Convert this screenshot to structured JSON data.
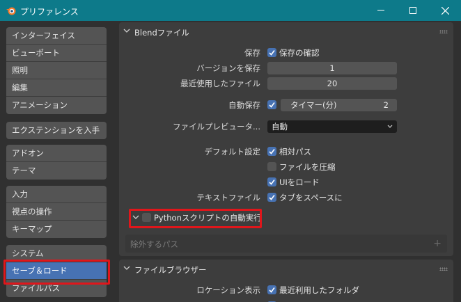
{
  "window": {
    "title": "プリファレンス",
    "minimize_glyph": "minimize",
    "maximize_glyph": "maximize",
    "close_glyph": "close"
  },
  "sidebar": {
    "groups": [
      [
        "インターフェイス",
        "ビューポート",
        "照明",
        "編集",
        "アニメーション"
      ],
      [
        "エクステンションを入手"
      ],
      [
        "アドオン",
        "テーマ"
      ],
      [
        "入力",
        "視点の操作",
        "キーマップ"
      ],
      [
        "システム",
        "セーブ＆ロード",
        "ファイルパス"
      ]
    ],
    "active": "セーブ＆ロード"
  },
  "blend_panel": {
    "title": "Blendファイル",
    "save_label": "保存",
    "save_confirm": "保存の確認",
    "save_versions_label": "バージョンを保存",
    "save_versions_value": "1",
    "recent_files_label": "最近使用したファイル",
    "recent_files_value": "20",
    "autosave_label": "自動保存",
    "timer_label": "タイマー(分)",
    "timer_value": "2",
    "file_preview_label": "ファイルプレビュータ...",
    "file_preview_value": "自動",
    "default_settings_label": "デフォルト設定",
    "relative_paths": "相対パス",
    "compress_file": "ファイルを圧縮",
    "load_ui": "UIをロード",
    "text_files_label": "テキストファイル",
    "tabs_as_spaces": "タブをスペースに"
  },
  "python_subpanel": {
    "title": "Pythonスクリプトの自動実行",
    "exclude_paths_placeholder": "除外するパス",
    "add_symbol": "+"
  },
  "file_browser_panel": {
    "title": "ファイルブラウザー",
    "locations_label": "ロケーション表示",
    "recent_folders": "最近利用したフォルダ"
  },
  "colors": {
    "titlebar": "#0d7a8a",
    "accent": "#4772b3",
    "highlight": "#e0161b"
  }
}
